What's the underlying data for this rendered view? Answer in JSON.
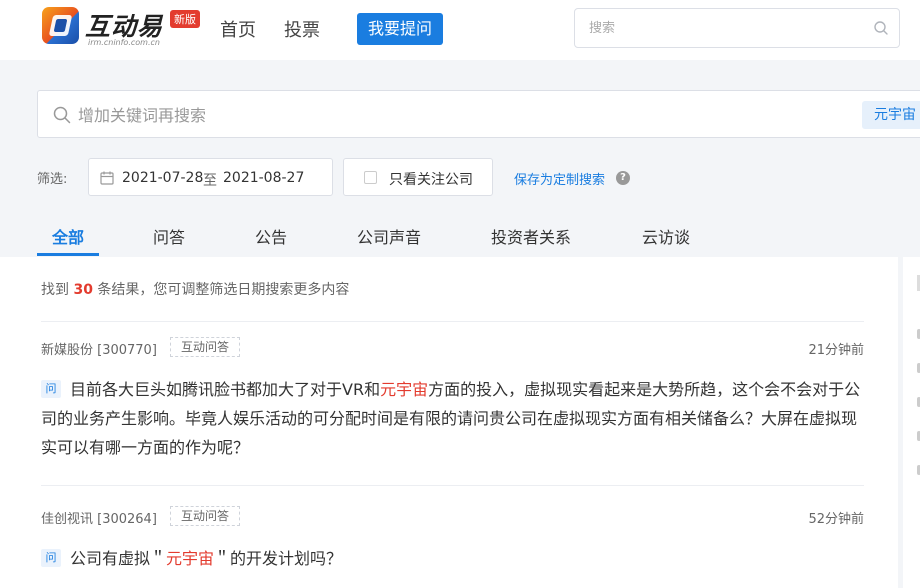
{
  "header": {
    "logo_text": "互动易",
    "logo_badge": "新版",
    "logo_sub": "irm.cninfo.com.cn",
    "nav": [
      "首页",
      "投票"
    ],
    "ask_button": "我要提问",
    "search_placeholder": "搜索"
  },
  "search": {
    "placeholder": "增加关键词再搜索",
    "keyword_tag": "元宇宙"
  },
  "filters": {
    "label": "筛选:",
    "date_start": "2021-07-28",
    "date_sep": "至",
    "date_end": "2021-08-27",
    "follow_only_label": "只看关注公司",
    "save_custom": "保存为定制搜索",
    "help": "?"
  },
  "tabs": [
    "全部",
    "问答",
    "公告",
    "公司声音",
    "投资者关系",
    "云访谈"
  ],
  "active_tab": 0,
  "results": {
    "prefix": "找到",
    "count": "30",
    "suffix": "条结果，您可调整筛选日期搜索更多内容"
  },
  "items": [
    {
      "company": "新媒股份 [300770]",
      "type": "互动问答",
      "time": "21分钟前",
      "badge": "问",
      "q_before": "目前各大巨头如腾讯脸书都加大了对于VR和",
      "q_highlight": "元宇宙",
      "q_after": "方面的投入，虚拟现实看起来是大势所趋，这个会不会对于公司的业务产生影响。毕竟人娱乐活动的可分配时间是有限的请问贵公司在虚拟现实方面有相关储备么？大屏在虚拟现实可以有哪一方面的作为呢？"
    },
    {
      "company": "佳创视讯 [300264]",
      "type": "互动问答",
      "time": "52分钟前",
      "badge": "问",
      "q_before": "公司有虚拟＂",
      "q_highlight": "元宇宙",
      "q_after": "＂的开发计划吗？"
    }
  ],
  "colors": {
    "accent": "#1a7de0",
    "highlight": "#e33b2e"
  }
}
